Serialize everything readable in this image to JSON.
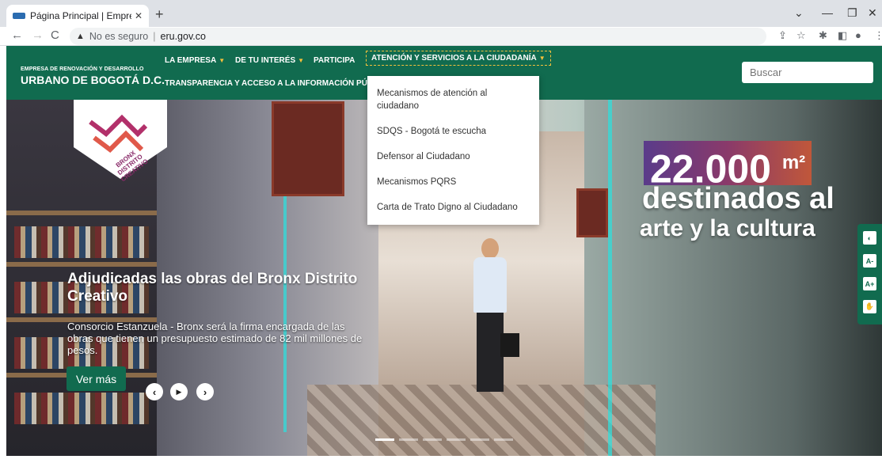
{
  "browser": {
    "tab_title": "Página Principal | Empresa de Re",
    "tab_close": "✕",
    "new_tab": "+",
    "not_secure": "No es seguro",
    "url": "eru.gov.co",
    "back": "←",
    "forward": "→",
    "reload": "C",
    "minimize": "—",
    "restore": "❐",
    "close": "✕",
    "tab_list": "⌄"
  },
  "site": {
    "logo_small": "EMPRESA DE RENOVACIÓN Y DESARROLLO",
    "logo_big": "URBANO DE BOGOTÁ D.C.",
    "nav": {
      "la_empresa": "LA EMPRESA",
      "de_tu_interes": "DE TU INTERÉS",
      "participa": "PARTICIPA",
      "atencion": "ATENCIÓN Y SERVICIOS A LA CIUDADANÍA",
      "transparencia": "TRANSPARENCIA Y ACCESO A LA INFORMACIÓN PÚBLI"
    },
    "search_placeholder": "Buscar"
  },
  "dropdown": {
    "items": [
      "Mecanismos de atención al ciudadano",
      "SDQS - Bogotá te escucha",
      "Defensor al Ciudadano",
      "Mecanismos PQRS",
      "Carta de Trato Digno al Ciudadano"
    ]
  },
  "hero": {
    "badge_line1": "BRONX",
    "badge_line2": "DISTRITO",
    "badge_line3": "CREATIVO",
    "headline": "Adjudicadas las obras del Bronx Distrito Creativo",
    "subtext": "Consorcio Estanzuela - Bronx será la firma encargada de las obras que tienen un presupuesto estimado de 82 mil millones de pesos.",
    "cta": "Ver más",
    "stat_number": "22.000",
    "stat_unit": "m²",
    "stat_line1": "destinados al",
    "stat_line2": "arte y la cultura",
    "prev": "‹",
    "play": "▶",
    "next": "›"
  },
  "accessibility": {
    "contrast": "◐",
    "font_smaller": "A-",
    "font_bigger": "A+",
    "sign_language": "✋"
  },
  "colors": {
    "brand_green": "#116b4f",
    "accent_yellow": "#f6c13c"
  }
}
